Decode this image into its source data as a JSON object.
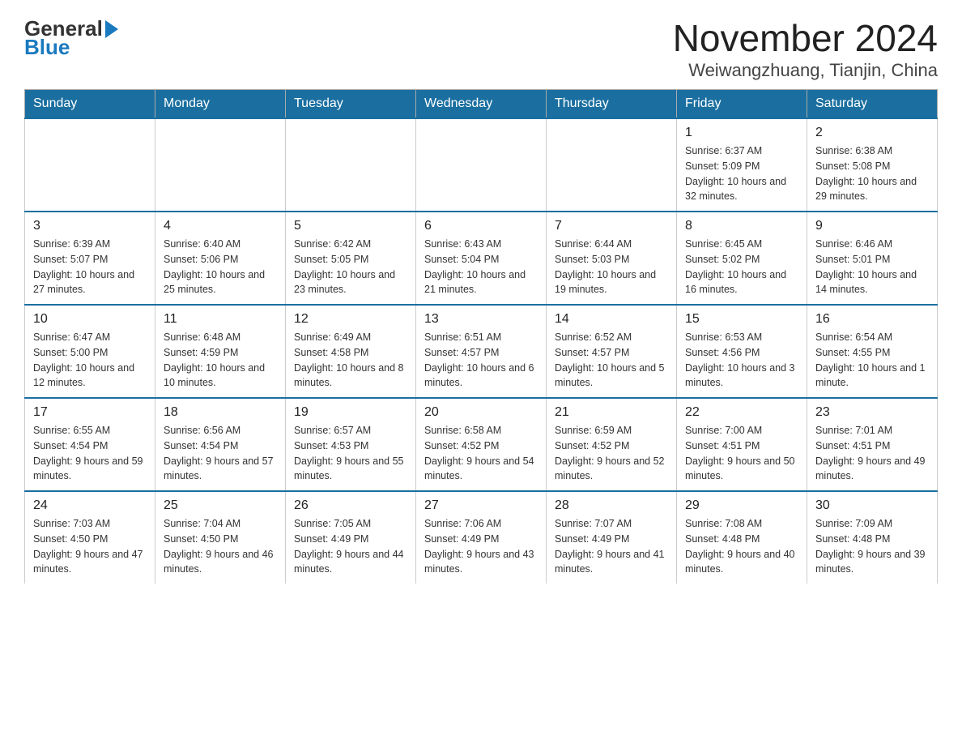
{
  "logo": {
    "text_general": "General",
    "text_blue": "Blue"
  },
  "title": "November 2024",
  "subtitle": "Weiwangzhuang, Tianjin, China",
  "days_of_week": [
    "Sunday",
    "Monday",
    "Tuesday",
    "Wednesday",
    "Thursday",
    "Friday",
    "Saturday"
  ],
  "weeks": [
    [
      {
        "day": "",
        "info": ""
      },
      {
        "day": "",
        "info": ""
      },
      {
        "day": "",
        "info": ""
      },
      {
        "day": "",
        "info": ""
      },
      {
        "day": "",
        "info": ""
      },
      {
        "day": "1",
        "info": "Sunrise: 6:37 AM\nSunset: 5:09 PM\nDaylight: 10 hours and 32 minutes."
      },
      {
        "day": "2",
        "info": "Sunrise: 6:38 AM\nSunset: 5:08 PM\nDaylight: 10 hours and 29 minutes."
      }
    ],
    [
      {
        "day": "3",
        "info": "Sunrise: 6:39 AM\nSunset: 5:07 PM\nDaylight: 10 hours and 27 minutes."
      },
      {
        "day": "4",
        "info": "Sunrise: 6:40 AM\nSunset: 5:06 PM\nDaylight: 10 hours and 25 minutes."
      },
      {
        "day": "5",
        "info": "Sunrise: 6:42 AM\nSunset: 5:05 PM\nDaylight: 10 hours and 23 minutes."
      },
      {
        "day": "6",
        "info": "Sunrise: 6:43 AM\nSunset: 5:04 PM\nDaylight: 10 hours and 21 minutes."
      },
      {
        "day": "7",
        "info": "Sunrise: 6:44 AM\nSunset: 5:03 PM\nDaylight: 10 hours and 19 minutes."
      },
      {
        "day": "8",
        "info": "Sunrise: 6:45 AM\nSunset: 5:02 PM\nDaylight: 10 hours and 16 minutes."
      },
      {
        "day": "9",
        "info": "Sunrise: 6:46 AM\nSunset: 5:01 PM\nDaylight: 10 hours and 14 minutes."
      }
    ],
    [
      {
        "day": "10",
        "info": "Sunrise: 6:47 AM\nSunset: 5:00 PM\nDaylight: 10 hours and 12 minutes."
      },
      {
        "day": "11",
        "info": "Sunrise: 6:48 AM\nSunset: 4:59 PM\nDaylight: 10 hours and 10 minutes."
      },
      {
        "day": "12",
        "info": "Sunrise: 6:49 AM\nSunset: 4:58 PM\nDaylight: 10 hours and 8 minutes."
      },
      {
        "day": "13",
        "info": "Sunrise: 6:51 AM\nSunset: 4:57 PM\nDaylight: 10 hours and 6 minutes."
      },
      {
        "day": "14",
        "info": "Sunrise: 6:52 AM\nSunset: 4:57 PM\nDaylight: 10 hours and 5 minutes."
      },
      {
        "day": "15",
        "info": "Sunrise: 6:53 AM\nSunset: 4:56 PM\nDaylight: 10 hours and 3 minutes."
      },
      {
        "day": "16",
        "info": "Sunrise: 6:54 AM\nSunset: 4:55 PM\nDaylight: 10 hours and 1 minute."
      }
    ],
    [
      {
        "day": "17",
        "info": "Sunrise: 6:55 AM\nSunset: 4:54 PM\nDaylight: 9 hours and 59 minutes."
      },
      {
        "day": "18",
        "info": "Sunrise: 6:56 AM\nSunset: 4:54 PM\nDaylight: 9 hours and 57 minutes."
      },
      {
        "day": "19",
        "info": "Sunrise: 6:57 AM\nSunset: 4:53 PM\nDaylight: 9 hours and 55 minutes."
      },
      {
        "day": "20",
        "info": "Sunrise: 6:58 AM\nSunset: 4:52 PM\nDaylight: 9 hours and 54 minutes."
      },
      {
        "day": "21",
        "info": "Sunrise: 6:59 AM\nSunset: 4:52 PM\nDaylight: 9 hours and 52 minutes."
      },
      {
        "day": "22",
        "info": "Sunrise: 7:00 AM\nSunset: 4:51 PM\nDaylight: 9 hours and 50 minutes."
      },
      {
        "day": "23",
        "info": "Sunrise: 7:01 AM\nSunset: 4:51 PM\nDaylight: 9 hours and 49 minutes."
      }
    ],
    [
      {
        "day": "24",
        "info": "Sunrise: 7:03 AM\nSunset: 4:50 PM\nDaylight: 9 hours and 47 minutes."
      },
      {
        "day": "25",
        "info": "Sunrise: 7:04 AM\nSunset: 4:50 PM\nDaylight: 9 hours and 46 minutes."
      },
      {
        "day": "26",
        "info": "Sunrise: 7:05 AM\nSunset: 4:49 PM\nDaylight: 9 hours and 44 minutes."
      },
      {
        "day": "27",
        "info": "Sunrise: 7:06 AM\nSunset: 4:49 PM\nDaylight: 9 hours and 43 minutes."
      },
      {
        "day": "28",
        "info": "Sunrise: 7:07 AM\nSunset: 4:49 PM\nDaylight: 9 hours and 41 minutes."
      },
      {
        "day": "29",
        "info": "Sunrise: 7:08 AM\nSunset: 4:48 PM\nDaylight: 9 hours and 40 minutes."
      },
      {
        "day": "30",
        "info": "Sunrise: 7:09 AM\nSunset: 4:48 PM\nDaylight: 9 hours and 39 minutes."
      }
    ]
  ]
}
